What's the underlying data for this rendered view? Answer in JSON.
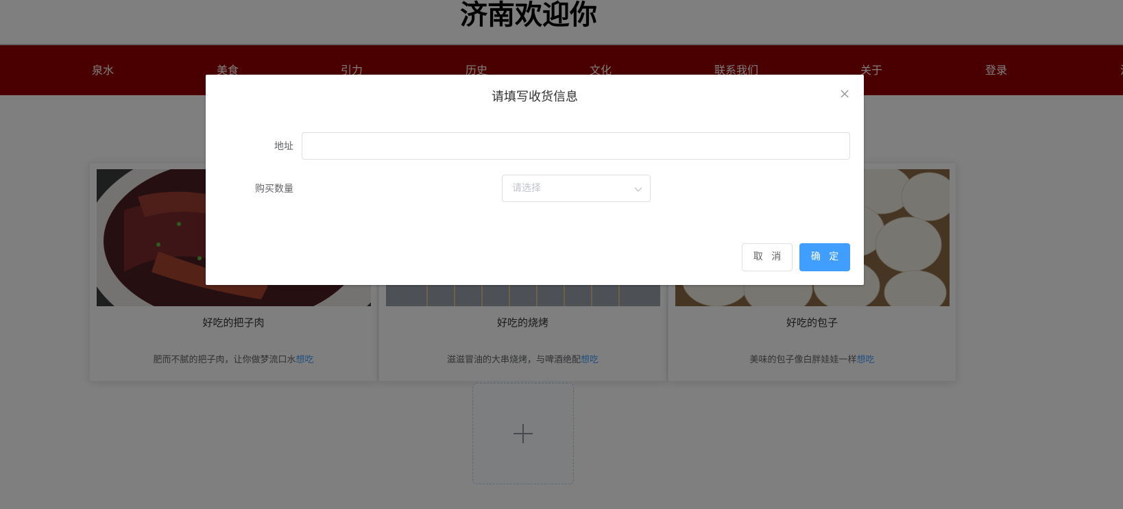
{
  "header": {
    "title": "济南欢迎你"
  },
  "nav": {
    "items": [
      {
        "label": "泉水"
      },
      {
        "label": "美食"
      },
      {
        "label": "引力"
      },
      {
        "label": "历史"
      },
      {
        "label": "文化"
      },
      {
        "label": "联系我们"
      },
      {
        "label": "关于"
      },
      {
        "label": "登录"
      },
      {
        "label": "注册"
      }
    ]
  },
  "cards": [
    {
      "title": "好吃的把子肉",
      "desc": "肥而不腻的把子肉，让你做梦流口水",
      "link": "想吃",
      "image_icon": "braised-pork-photo"
    },
    {
      "title": "好吃的烧烤",
      "desc": "滋滋冒油的大串烧烤，与啤酒绝配",
      "link": "想吃",
      "image_icon": "barbecue-photo"
    },
    {
      "title": "好吃的包子",
      "desc": "美味的包子像白胖娃娃一样",
      "link": "想吃",
      "image_icon": "steamed-buns-photo"
    }
  ],
  "upload": {
    "icon": "plus-icon"
  },
  "dialog": {
    "title": "请填写收货信息",
    "close_icon": "close-icon",
    "address_label": "地址",
    "address_value": "",
    "quantity_label": "购买数量",
    "quantity_placeholder": "请选择",
    "cancel_label": "取 消",
    "confirm_label": "确 定"
  },
  "colors": {
    "nav_bg": "#960000",
    "primary": "#409eff",
    "link": "#409eff"
  }
}
